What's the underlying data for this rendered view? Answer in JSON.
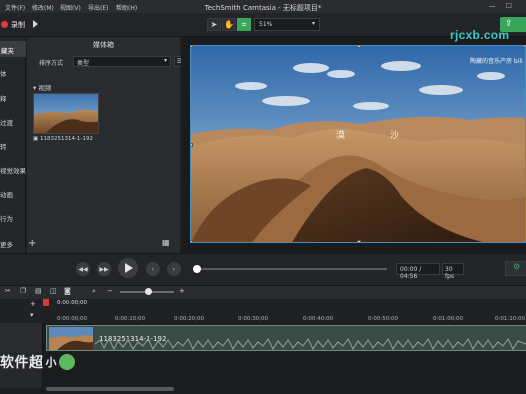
{
  "window": {
    "title": "TechSmith Camtasia - 无标题项目*",
    "menu": [
      "文件(F)",
      "修改(M)",
      "视图(V)",
      "导出(E)",
      "帮助(H)"
    ],
    "controls": [
      "—",
      "☐"
    ]
  },
  "toolbar": {
    "record_label": "录制",
    "zoom_value": "51%",
    "share_label": "⇪"
  },
  "brand_watermark": "rjcxb.com",
  "sidebar": {
    "items": [
      "藏夹",
      "体",
      "释",
      "过渡",
      "转",
      "视觉效果",
      "动画",
      "行为",
      "更多"
    ]
  },
  "media_bin": {
    "title": "媒体箱",
    "sort_label": "排序方式",
    "sort_value": "类型",
    "section": "视频",
    "media_caption": "1183251314-1-192",
    "add": "+",
    "grid": "▦"
  },
  "canvas": {
    "text_left": "漠",
    "text_right": "沙",
    "logo_text": "陶藏的音乐产房 bili"
  },
  "playback": {
    "time": "00:00 / 04:56",
    "fps": "30 fps"
  },
  "timeline": {
    "playhead_time": "0:00:00;00",
    "ticks": [
      "0:00:00;00",
      "0:00:10;00",
      "0:00:20;00",
      "0:00:30;00",
      "0:00:40;00",
      "0:00:50;00",
      "0:01:00;00",
      "0:01:10;00"
    ],
    "clip_label": "1183251314-1-192"
  },
  "footer_watermark": {
    "text": "软件超",
    "small": "小"
  },
  "colors": {
    "accent_green": "#3ba55c",
    "record_red": "#e0393e",
    "brand_teal": "#3cc9c8"
  }
}
